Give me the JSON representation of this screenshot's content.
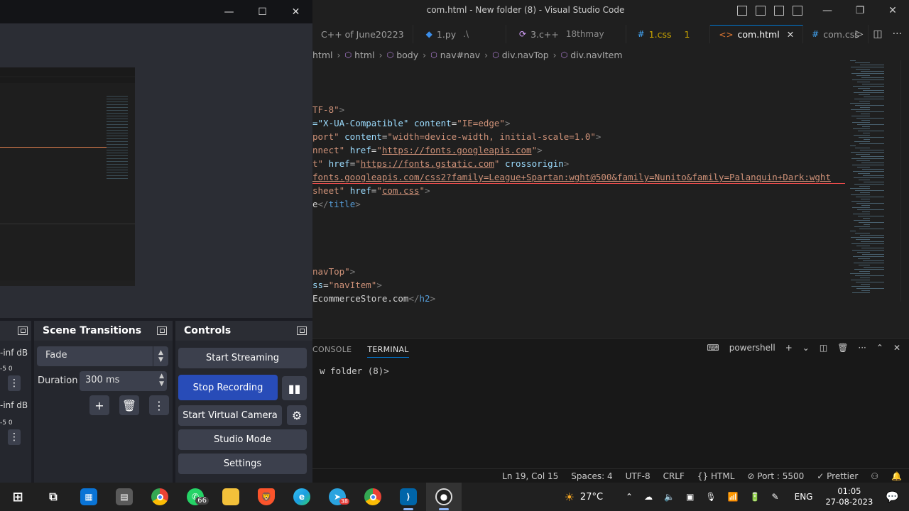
{
  "vscode": {
    "title": "com.html - New folder (8) - Visual Studio Code",
    "tabs": [
      {
        "label": "C++ of June20223",
        "icon": "",
        "extra": "",
        "badge": ""
      },
      {
        "label": "1.py",
        "icon": "◆",
        "extra": ".\\",
        "badge": ""
      },
      {
        "label": "3.c++",
        "icon": "⟳",
        "extra": "18thmay",
        "badge": ""
      },
      {
        "label": "1.css",
        "icon": "#",
        "extra": "",
        "badge": "1"
      },
      {
        "label": "com.html",
        "icon": "<>",
        "extra": "",
        "badge": "",
        "active": true
      },
      {
        "label": "com.css",
        "icon": "#",
        "extra": "",
        "badge": ""
      }
    ],
    "breadcrumb": [
      "html",
      "html",
      "body",
      "nav#nav",
      "div.navTop",
      "div.navItem"
    ],
    "code_lines": [
      [
        [
          "c-str",
          "TF-8\""
        ],
        [
          "c-tag",
          ">"
        ]
      ],
      [
        [
          "c-attr",
          "=\"X-UA-Compatible\" "
        ],
        [
          "c-attr",
          "content"
        ],
        [
          "c-txt",
          "="
        ],
        [
          "c-str",
          "\"IE=edge\""
        ],
        [
          "c-tag",
          ">"
        ]
      ],
      [
        [
          "c-str",
          "port\" "
        ],
        [
          "c-attr",
          "content"
        ],
        [
          "c-txt",
          "="
        ],
        [
          "c-str",
          "\"width=device-width, initial-scale=1.0\""
        ],
        [
          "c-tag",
          ">"
        ]
      ],
      [
        [
          "c-str",
          "nnect\" "
        ],
        [
          "c-attr",
          "href"
        ],
        [
          "c-txt",
          "="
        ],
        [
          "c-str",
          "\""
        ],
        [
          "c-url",
          "https://fonts.googleapis.com"
        ],
        [
          "c-str",
          "\""
        ],
        [
          "c-tag",
          ">"
        ]
      ],
      [
        [
          "c-str",
          "t\" "
        ],
        [
          "c-attr",
          "href"
        ],
        [
          "c-txt",
          "="
        ],
        [
          "c-str",
          "\""
        ],
        [
          "c-url",
          "https://fonts.gstatic.com"
        ],
        [
          "c-str",
          "\" "
        ],
        [
          "c-attr",
          "crossorigin"
        ],
        [
          "c-tag",
          ">"
        ]
      ],
      [
        [
          "c-url",
          "fonts.googleapis.com/css2?family=League+Spartan:wght@500&family=Nunito&family=Palanquin+Dark:wght"
        ]
      ],
      [
        [
          "c-str",
          "sheet\" "
        ],
        [
          "c-attr",
          "href"
        ],
        [
          "c-txt",
          "="
        ],
        [
          "c-str",
          "\""
        ],
        [
          "c-url",
          "com.css"
        ],
        [
          "c-str",
          "\""
        ],
        [
          "c-tag",
          ">"
        ]
      ],
      [
        [
          "c-txt",
          "e"
        ],
        [
          "c-tag",
          "</"
        ],
        [
          "c-name",
          "title"
        ],
        [
          "c-tag",
          ">"
        ]
      ],
      [],
      [],
      [],
      [],
      [
        [
          "c-str",
          "navTop\""
        ],
        [
          "c-tag",
          ">"
        ]
      ],
      [
        [
          "c-attr",
          "ss"
        ],
        [
          "c-txt",
          "="
        ],
        [
          "c-str",
          "\"navItem\""
        ],
        [
          "c-tag",
          ">"
        ]
      ],
      [
        [
          "c-txt",
          "EcommerceStore.com"
        ],
        [
          "c-tag",
          "</"
        ],
        [
          "c-name",
          "h2"
        ],
        [
          "c-tag",
          ">"
        ]
      ]
    ],
    "panel_tabs": [
      "CONSOLE",
      "TERMINAL"
    ],
    "terminal_shell": "powershell",
    "terminal_line": "w folder (8)>",
    "status": [
      "Ln 19, Col 15",
      "Spaces: 4",
      "UTF-8",
      "CRLF",
      "{} HTML",
      "⊘ Port : 5500",
      "✓ Prettier"
    ]
  },
  "obs": {
    "scene_transitions": {
      "title": "Scene Transitions",
      "transition": "Fade",
      "duration_label": "Duration",
      "duration_value": "300 ms"
    },
    "controls": {
      "title": "Controls",
      "start_streaming": "Start Streaming",
      "stop_recording": "Stop Recording",
      "start_virtual_camera": "Start Virtual Camera",
      "studio_mode": "Studio Mode",
      "settings": "Settings"
    },
    "audio": {
      "level1": "-inf dB",
      "level2": "-inf dB",
      "scale": "-5    0"
    }
  },
  "taskbar": {
    "weather": "27°C",
    "language": "ENG",
    "time": "01:05",
    "date": "27-08-2023",
    "whatsapp_badge": "66",
    "telegram_badge": "38"
  },
  "colors": {
    "vscode_bg": "#1f1f1f",
    "obs_panel": "#25272e",
    "obs_button": "#3c404d",
    "recording_blue": "#284cb8",
    "taskbar": "#202020"
  }
}
